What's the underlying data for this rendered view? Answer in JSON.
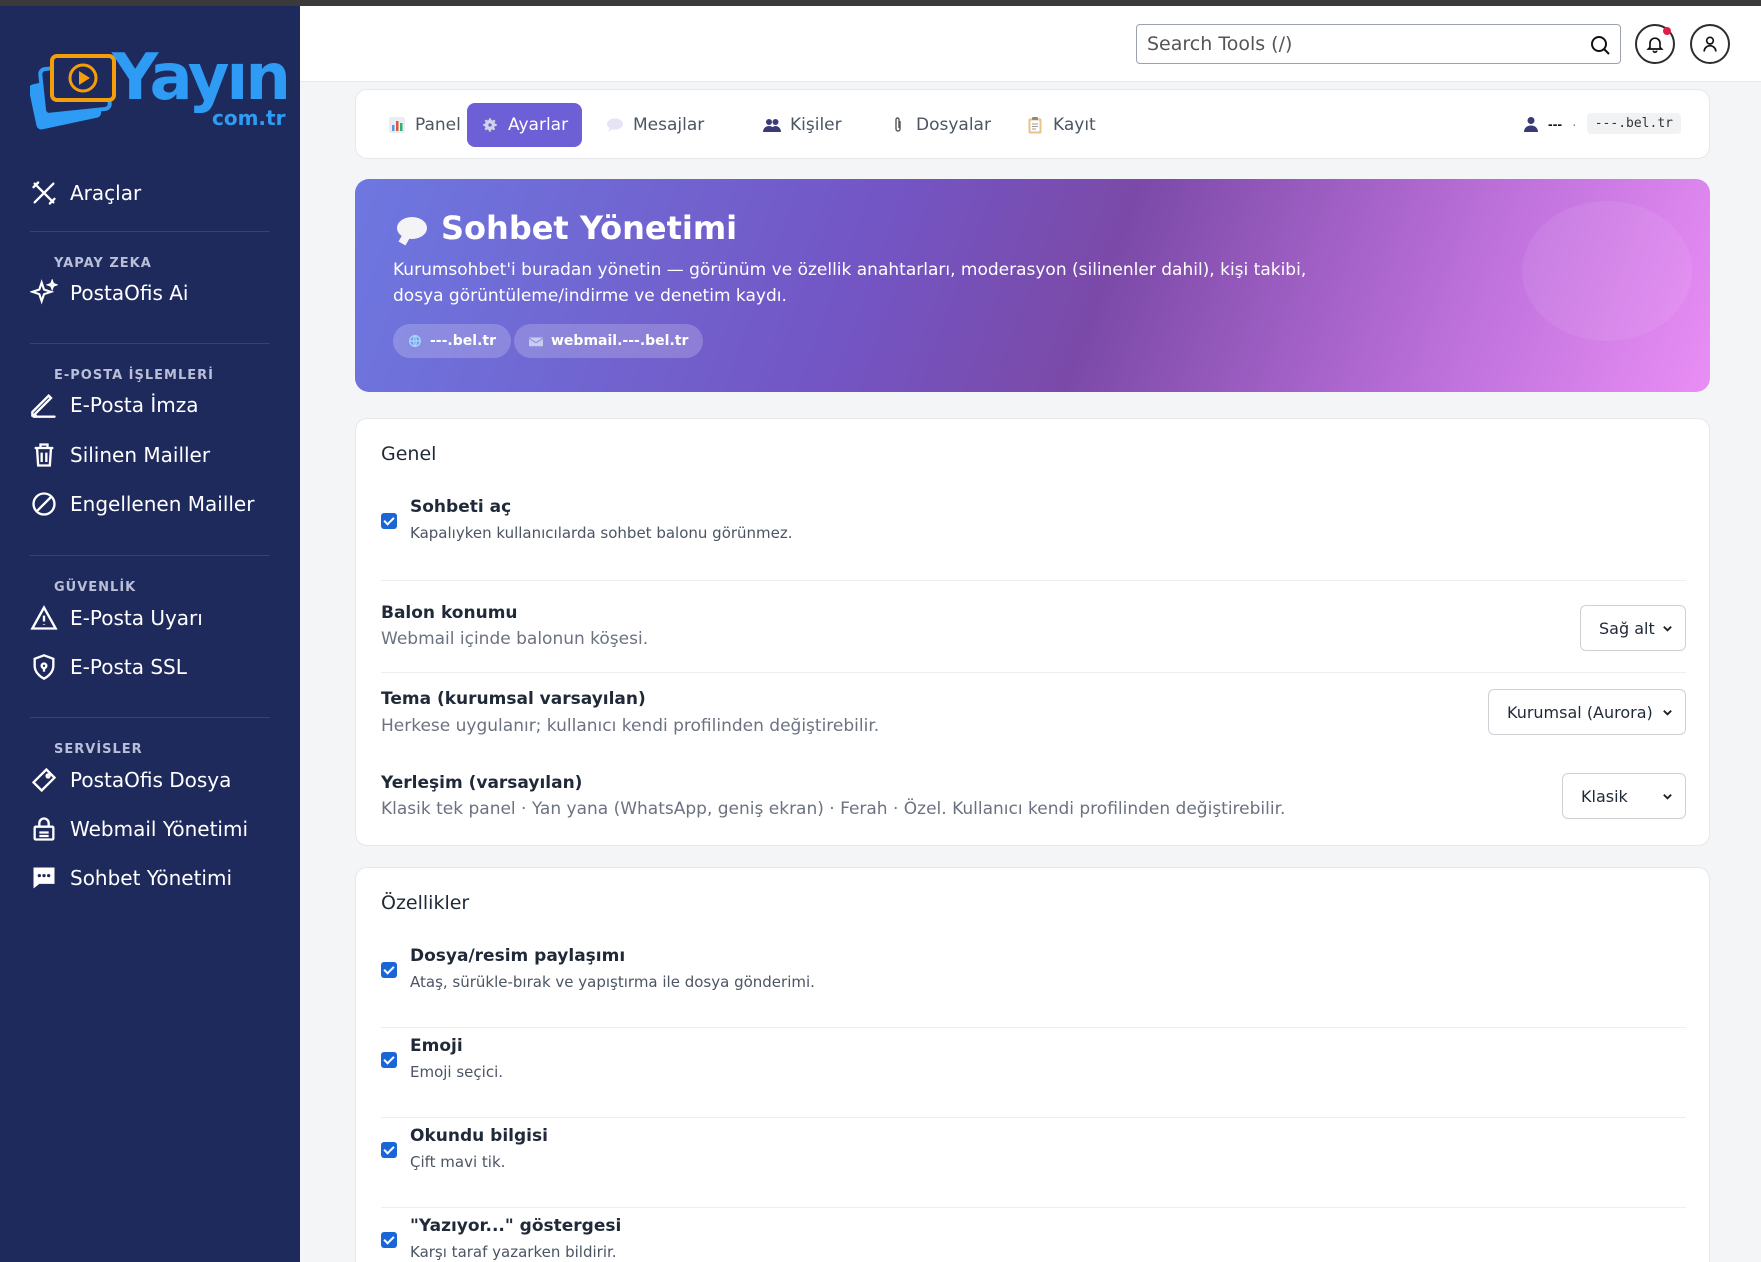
{
  "brand": {
    "logo_word": "Yayın",
    "logo_sub": "com.tr",
    "colors": {
      "sidebar": "#1f2a5c",
      "accent": "#6d5fd6",
      "logo": "#2e9cf4",
      "checkbox": "#1a66d6"
    }
  },
  "sidebar": {
    "tools": {
      "label": "Araçlar",
      "icon": "tools-icon"
    },
    "sections": [
      {
        "title": "YAPAY ZEKA",
        "items": [
          {
            "label": "PostaOfis Ai",
            "icon": "sparkle-icon"
          }
        ]
      },
      {
        "title": "E-POSTA İŞLEMLERİ",
        "items": [
          {
            "label": "E-Posta İmza",
            "icon": "pen-icon"
          },
          {
            "label": "Silinen Mailler",
            "icon": "trash-icon"
          },
          {
            "label": "Engellenen Mailler",
            "icon": "block-icon"
          }
        ]
      },
      {
        "title": "GÜVENLİK",
        "items": [
          {
            "label": "E-Posta Uyarı",
            "icon": "warning-icon"
          },
          {
            "label": "E-Posta SSL",
            "icon": "shield-icon"
          }
        ]
      },
      {
        "title": "SERVİSLER",
        "items": [
          {
            "label": "PostaOfis Dosya",
            "icon": "tag-icon"
          },
          {
            "label": "Webmail Yönetimi",
            "icon": "lock-icon"
          },
          {
            "label": "Sohbet Yönetimi",
            "icon": "chat-icon"
          }
        ]
      }
    ]
  },
  "header": {
    "search_placeholder": "Search Tools (/)"
  },
  "tabs": [
    {
      "label": "Panel",
      "icon": "chart-icon"
    },
    {
      "label": "Ayarlar",
      "icon": "gear-icon",
      "active": true
    },
    {
      "label": "Mesajlar",
      "icon": "speech-icon"
    },
    {
      "label": "Kişiler",
      "icon": "people-icon"
    },
    {
      "label": "Dosyalar",
      "icon": "paperclip-icon"
    },
    {
      "label": "Kayıt",
      "icon": "clipboard-icon"
    }
  ],
  "user": {
    "name": "---",
    "separator": "·",
    "domain": "---.bel.tr"
  },
  "hero": {
    "title": "Sohbet Yönetimi",
    "description": "Kurumsohbet'i buradan yönetin — görünüm ve özellik anahtarları, moderasyon (silinenler dahil), kişi takibi, dosya görüntüleme/indirme ve denetim kaydı.",
    "chips": [
      {
        "label": "---.bel.tr",
        "icon": "globe-icon"
      },
      {
        "label": "webmail.---.bel.tr",
        "icon": "mail-icon"
      }
    ]
  },
  "genel": {
    "title": "Genel",
    "open_chat": {
      "label": "Sohbeti aç",
      "desc": "Kapalıyken kullanıcılarda sohbet balonu görünmez.",
      "checked": true
    },
    "bubble_position": {
      "label": "Balon konumu",
      "desc": "Webmail içinde balonun köşesi.",
      "value": "Sağ alt"
    },
    "theme": {
      "label": "Tema (kurumsal varsayılan)",
      "desc": "Herkese uygulanır; kullanıcı kendi profilinden değiştirebilir.",
      "value": "Kurumsal (Aurora)"
    },
    "layout": {
      "label": "Yerleşim (varsayılan)",
      "desc": "Klasik tek panel · Yan yana (WhatsApp, geniş ekran) · Ferah · Özel. Kullanıcı kendi profilinden değiştirebilir.",
      "value": "Klasik"
    }
  },
  "ozellikler": {
    "title": "Özellikler",
    "items": [
      {
        "label": "Dosya/resim paylaşımı",
        "desc": "Ataş, sürükle-bırak ve yapıştırma ile dosya gönderimi.",
        "checked": true
      },
      {
        "label": "Emoji",
        "desc": "Emoji seçici.",
        "checked": true
      },
      {
        "label": "Okundu bilgisi",
        "desc": "Çift mavi tik.",
        "checked": true
      },
      {
        "label": "\"Yazıyor...\" göstergesi",
        "desc": "Karşı taraf yazarken bildirir.",
        "checked": true
      }
    ]
  }
}
